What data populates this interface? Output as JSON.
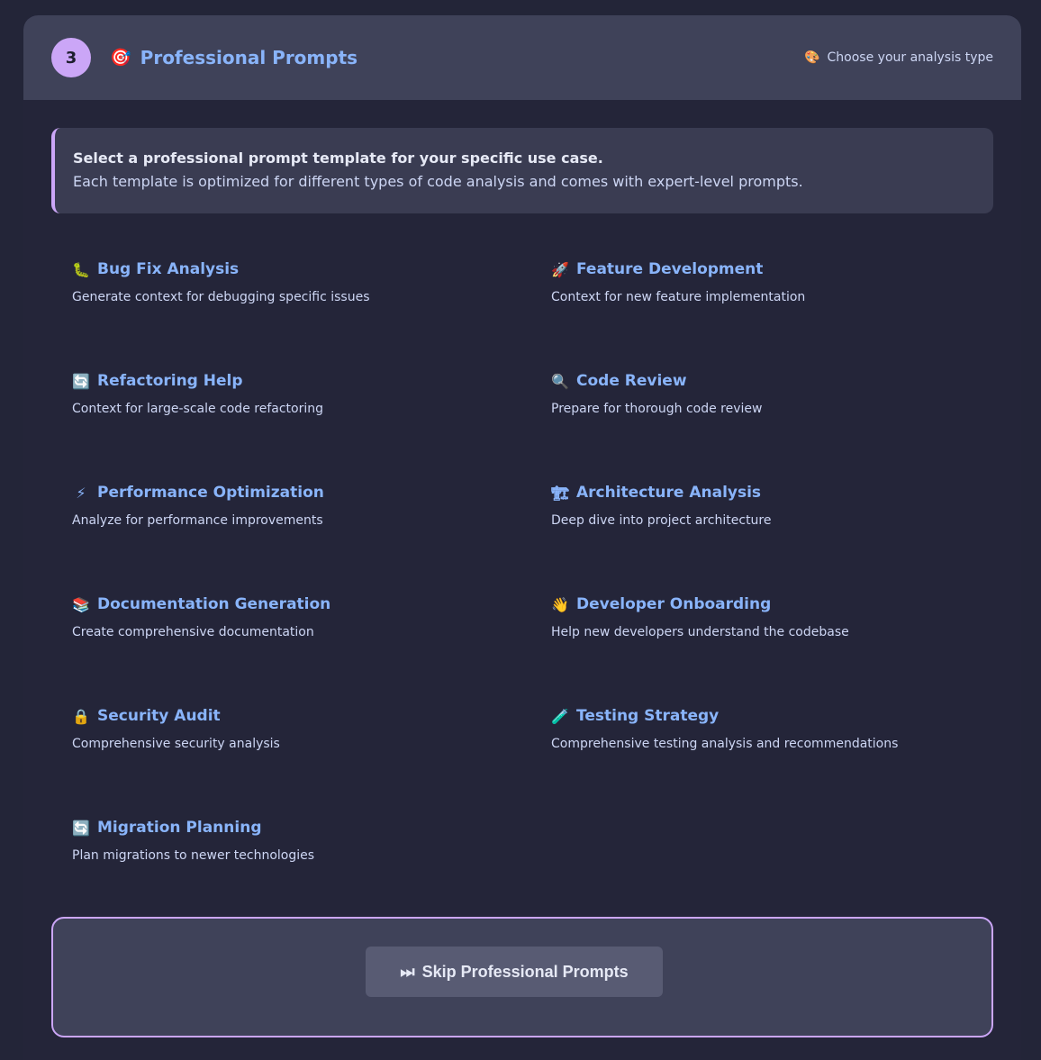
{
  "step": {
    "number": "3",
    "icon": "🎯",
    "title": "Professional Prompts",
    "hint_icon": "🎨",
    "hint": "Choose your analysis type"
  },
  "info": {
    "heading": "Select a professional prompt template for your specific use case.",
    "text": "Each template is optimized for different types of code analysis and comes with expert-level prompts."
  },
  "templates": [
    {
      "icon": "🐛",
      "title": "Bug Fix Analysis",
      "desc": "Generate context for debugging specific issues"
    },
    {
      "icon": "🚀",
      "title": "Feature Development",
      "desc": "Context for new feature implementation"
    },
    {
      "icon": "🔄",
      "title": "Refactoring Help",
      "desc": "Context for large-scale code refactoring"
    },
    {
      "icon": "🔍",
      "title": "Code Review",
      "desc": "Prepare for thorough code review"
    },
    {
      "icon": "⚡",
      "title": "Performance Optimization",
      "desc": "Analyze for performance improvements"
    },
    {
      "icon": "🏗",
      "title": "Architecture Analysis",
      "desc": "Deep dive into project architecture"
    },
    {
      "icon": "📚",
      "title": "Documentation Generation",
      "desc": "Create comprehensive documentation"
    },
    {
      "icon": "👋",
      "title": "Developer Onboarding",
      "desc": "Help new developers understand the codebase"
    },
    {
      "icon": "🔒",
      "title": "Security Audit",
      "desc": "Comprehensive security analysis"
    },
    {
      "icon": "🧪",
      "title": "Testing Strategy",
      "desc": "Comprehensive testing analysis and recommendations"
    },
    {
      "icon": "🔄",
      "title": "Migration Planning",
      "desc": "Plan migrations to newer technologies"
    }
  ],
  "skip": {
    "icon": "⏭",
    "label": "Skip Professional Prompts"
  }
}
